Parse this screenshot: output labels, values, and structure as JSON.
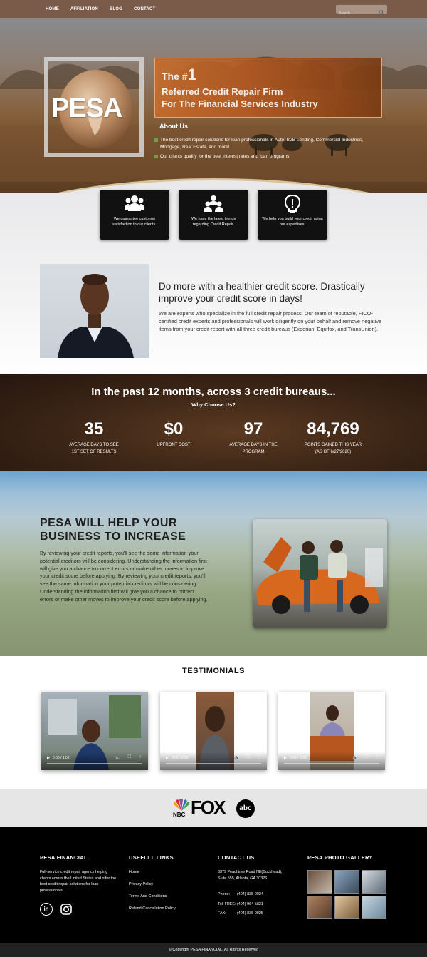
{
  "nav": {
    "links": [
      "HOME",
      "AFFILIATION",
      "BLOG",
      "CONTACT"
    ],
    "search_placeholder": "Search"
  },
  "hero": {
    "logo_text": "PESA",
    "banner_the": "The #",
    "banner_number": "1",
    "banner_line1": "Referred Credit Repair Firm",
    "banner_line2": "For The Financial Services Industry",
    "about_title": "About Us",
    "about_items": [
      "The best credit repair solutions for loan professionals in Auto, B2B Lending, Commercial Industries, Mortgage, Real Estate, and more!",
      "Our clients qualify for the best interest rates and loan programs."
    ],
    "accent_color": "#6ca04a"
  },
  "features": [
    {
      "icon": "users-icon",
      "text": "We guarantee customer satisfaction to our clients."
    },
    {
      "icon": "users-icon",
      "text": "We have the latest trends regarding Credit Repair."
    },
    {
      "icon": "lightbulb-icon",
      "text": "We help you build your credit using our expertises."
    }
  ],
  "intro": {
    "title": "Do more with a healthier credit score. Drastically improve your credit score in days!",
    "text": "We are experts who specialize in the full credit repair process. Our team of reputable, FICO-certified credit experts and professionals will work diligently on your behalf and remove negative items from your credit report with all three credit bureaus (Experian, Equifax, and TransUnion)."
  },
  "stats": {
    "title": "In the past 12 months, across 3 credit bureaus...",
    "subtitle": "Why Choose Us?",
    "items": [
      {
        "num": "35",
        "l1": "AVERAGE DAYS TO SEE",
        "l2": "1ST SET OF RESULTS"
      },
      {
        "num": "$0",
        "l1": "UPFRONT COST",
        "l2": ""
      },
      {
        "num": "97",
        "l1": "AVERAGE DAYS IN THE",
        "l2": "PROGRAM"
      },
      {
        "num": "84,769",
        "l1": "POINTS GAINED THIS YEAR",
        "l2": "(AS OF 6/27/2020)"
      }
    ]
  },
  "business": {
    "title_line1": "PESA WILL HELP YOUR",
    "title_line2": "BUSINESS TO INCREASE",
    "text": "By reviewing your credit reports, you'll see the same information your potential creditors will be considering. Understanding the information first will give you a chance to correct errors or make other moves to improve your credit score before applying. By reviewing your credit reports, you'll see the same information your potential creditors will be considering. Understanding the information first will give you a chance to correct errors or make other moves to improve your credit score before applying."
  },
  "testimonials": {
    "title": "TESTIMONIALS",
    "videos": [
      {
        "time": "0:00 / 1:02"
      },
      {
        "time": "0:00 / 0:25"
      },
      {
        "time": "0:00 / 0:33"
      }
    ]
  },
  "logos": {
    "nbc": "NBC",
    "fox": "FOX",
    "abc": "abc"
  },
  "footer": {
    "col1_title": "PESA FINANCIAL",
    "col1_text": "Full-service credit repair agency helping clients across the United States and offer the best credit repair solutions for loan professionals.",
    "col2_title": "USEFULL LINKS",
    "links": [
      "Home",
      "Privacy Policy",
      "Terms And Conditions",
      "Refund Cancellation Policy"
    ],
    "col3_title": "CONTACT US",
    "address_l1": "3379 Peachtree Road NE(Buckhead),",
    "address_l2": "Suite 555, Atlanta, GA 30326",
    "phone_label": "Phone:",
    "phone": "(404) 835-0024",
    "tollfree_label": "Toll FREE:",
    "tollfree": "(404) 964-5831",
    "fax_label": "FAX:",
    "fax": "(404) 835-0025",
    "col4_title": "PESA PHOTO GALLERY",
    "copyright": "© Copyright PESA FINANCIAL. All Rights Reserved"
  }
}
